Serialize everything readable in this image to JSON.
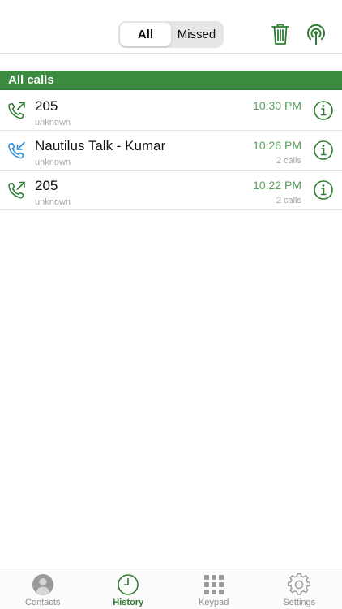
{
  "header": {
    "segments": [
      "All",
      "Missed"
    ],
    "selected_segment": "All",
    "actions": [
      {
        "name": "trash-icon",
        "color": "#2e7d32"
      },
      {
        "name": "antenna-icon",
        "color": "#2e7d32"
      }
    ]
  },
  "section": {
    "title": "All calls"
  },
  "calls": [
    {
      "name": "205",
      "sub": "unknown",
      "time": "10:30 PM",
      "count": "",
      "direction": "outgoing",
      "icon": "outgoing-call-icon"
    },
    {
      "name": "Nautilus Talk - Kumar",
      "sub": "unknown",
      "time": "10:26 PM",
      "count": "2 calls",
      "direction": "incoming",
      "icon": "incoming-call-icon"
    },
    {
      "name": "205",
      "sub": "unknown",
      "time": "10:22 PM",
      "count": "2 calls",
      "direction": "outgoing",
      "icon": "outgoing-call-icon"
    }
  ],
  "tabs": [
    {
      "label": "Contacts",
      "icon": "contacts-icon",
      "active": false
    },
    {
      "label": "History",
      "icon": "clock-icon",
      "active": true
    },
    {
      "label": "Keypad",
      "icon": "keypad-icon",
      "active": false
    },
    {
      "label": "Settings",
      "icon": "gear-icon",
      "active": false
    }
  ],
  "colors": {
    "accent": "#2e7d32",
    "section_header": "#3a8a3f",
    "time_text": "#5a9e5d",
    "incoming_arrow": "#2f8fd6"
  }
}
